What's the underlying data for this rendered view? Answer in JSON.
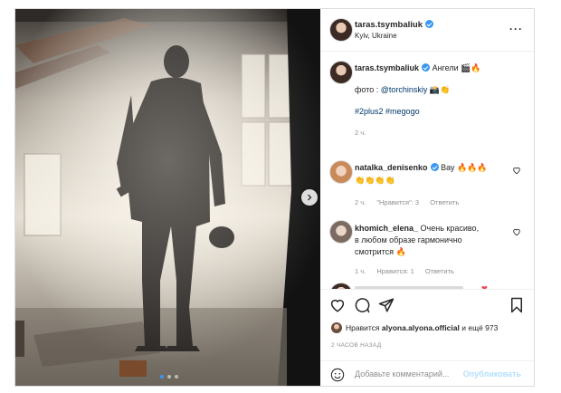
{
  "post": {
    "author": "taras.tsymbaliuk",
    "location": "Kyiv, Ukraine",
    "caption_text": "Ангели",
    "caption_emoji": "🎬🔥",
    "photo_credit_prefix": "фото : ",
    "photo_credit_handle": "@torchinskiy",
    "photo_credit_emoji": "📸👏",
    "hashtags": [
      "#2plus2",
      "#megogo"
    ],
    "caption_time": "2 ч.",
    "carousel": {
      "total": 3,
      "current": 1
    }
  },
  "comments": [
    {
      "user": "natalka_denisenko",
      "verified": true,
      "text": "Вау",
      "emoji": "🔥🔥🔥",
      "emoji2": "👏👏👏👏",
      "time": "2 ч.",
      "likes": "\"Нравится\": 3",
      "reply": "Ответить"
    },
    {
      "user": "khomich_elena_",
      "verified": false,
      "text_line1": "Очень красиво,",
      "text_line2": "в любом образе гармонично",
      "text_line3": "смотрится",
      "emoji": "🔥",
      "time": "1 ч.",
      "likes": "Нравится: 1",
      "reply": "Ответить"
    }
  ],
  "actions": {
    "liked_by_prefix": "Нравится",
    "liked_by_user": "alyona.alyona.official",
    "liked_by_suffix": "и ещё 973",
    "timestamp": "2 ЧАСОВ НАЗАД",
    "comment_placeholder": "Добавьте комментарий...",
    "publish_label": "Опубликовать"
  },
  "colors": {
    "verified": "#3897f0",
    "link": "#00376b",
    "muted": "#8e8e8e",
    "publish_disabled": "#b2dffc"
  }
}
